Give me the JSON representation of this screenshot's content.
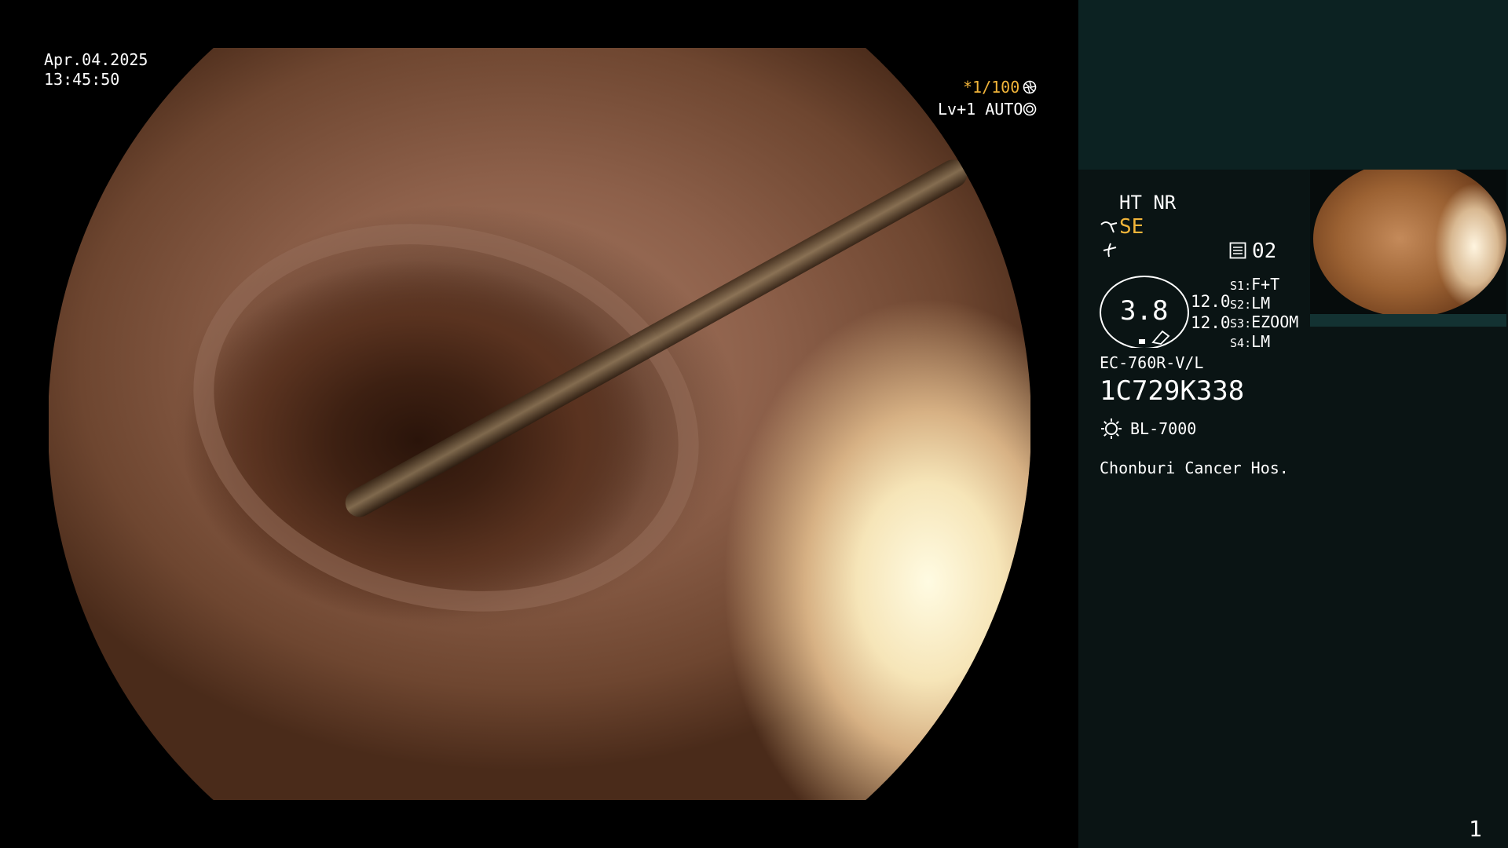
{
  "overlay": {
    "date": "Apr.04.2025",
    "time": "13:45:50",
    "shutter": "*1/100",
    "level_mode": "Lv+1 AUTO"
  },
  "panel": {
    "modes": "HT NR",
    "se_label": "SE",
    "color_level": "02",
    "gauge_value": "3.8",
    "value_1": "12.0",
    "value_2": "12.0",
    "switches": [
      {
        "key": "S1",
        "value": "F+T"
      },
      {
        "key": "S2",
        "value": "LM"
      },
      {
        "key": "S3",
        "value": "EZOOM"
      },
      {
        "key": "S4",
        "value": "LM"
      }
    ],
    "scope_model": "EC-760R-V/L",
    "scope_serial": "1C729K338",
    "light_source": "BL-7000",
    "hospital": "Chonburi Cancer Hos.",
    "page_number": "1"
  },
  "colors": {
    "accent_orange": "#f2b53a",
    "panel_dark": "#0a1414",
    "panel_teal": "#0c2222"
  },
  "icons": [
    "aperture-icon",
    "iris-icon",
    "water-jet-icon",
    "air-icon",
    "color-enhance-icon",
    "light-source-icon"
  ]
}
